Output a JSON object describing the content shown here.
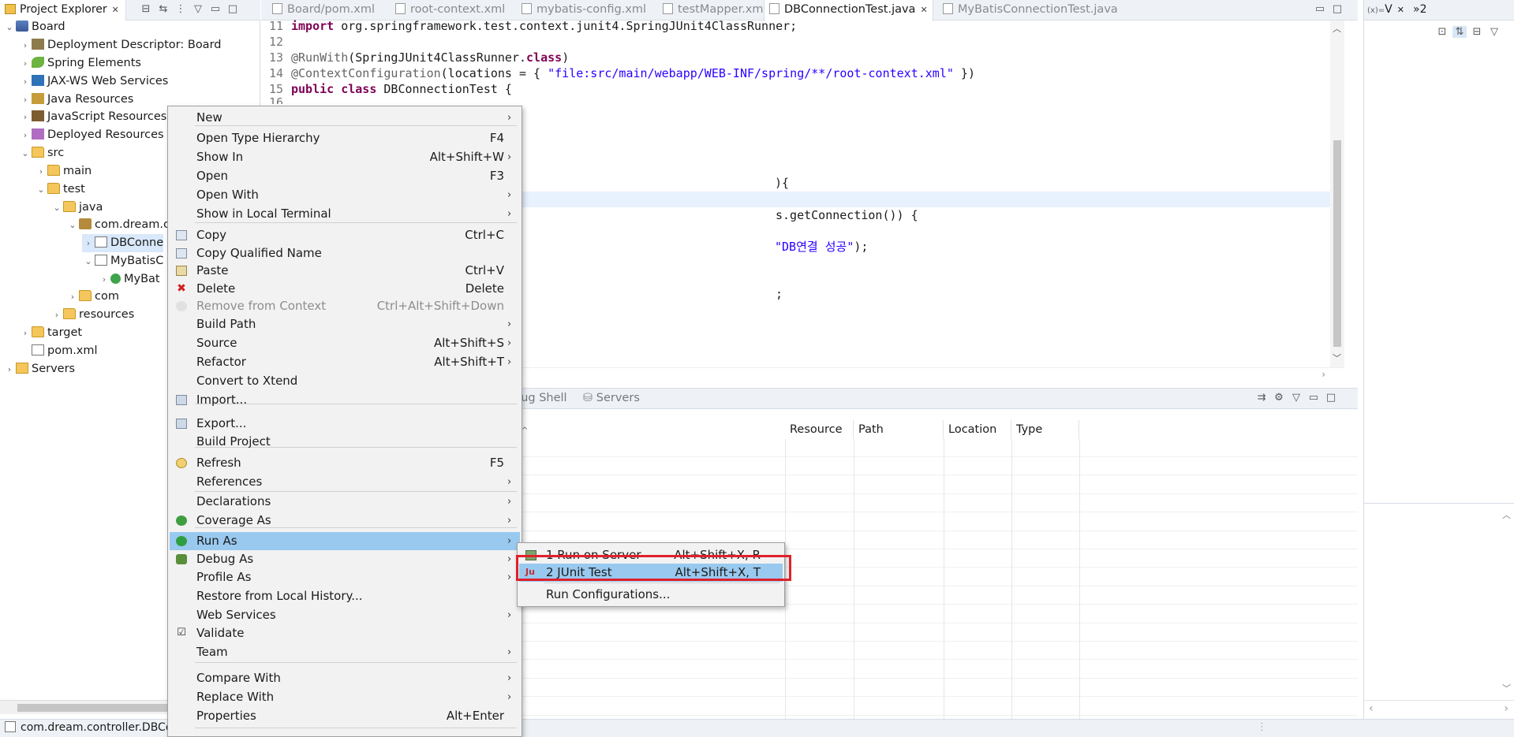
{
  "project_explorer": {
    "tab_label": "Project Explorer",
    "close_glyph": "✕",
    "toolbar_icons": [
      "collapse-all-icon",
      "link-with-editor-icon",
      "view-menu-icon",
      "minimize-icon",
      "maximize-icon"
    ],
    "tree": [
      {
        "label": "Board",
        "icon": "project-icon",
        "twisty": "⌄",
        "level": 0
      },
      {
        "label": "Deployment Descriptor: Board",
        "icon": "deployment-descriptor-icon",
        "twisty": "›",
        "level": 1
      },
      {
        "label": "Spring Elements",
        "icon": "spring-icon",
        "twisty": "›",
        "level": 1
      },
      {
        "label": "JAX-WS Web Services",
        "icon": "jaxws-icon",
        "twisty": "›",
        "level": 1
      },
      {
        "label": "Java Resources",
        "icon": "java-resources-icon",
        "twisty": "›",
        "level": 1
      },
      {
        "label": "JavaScript Resources",
        "icon": "javascript-resources-icon",
        "twisty": "›",
        "level": 1
      },
      {
        "label": "Deployed Resources",
        "icon": "deployed-resources-icon",
        "twisty": "›",
        "level": 1
      },
      {
        "label": "src",
        "icon": "folder-icon",
        "twisty": "⌄",
        "level": 1
      },
      {
        "label": "main",
        "icon": "folder-icon",
        "twisty": "›",
        "level": 2
      },
      {
        "label": "test",
        "icon": "folder-icon",
        "twisty": "⌄",
        "level": 2
      },
      {
        "label": "java",
        "icon": "folder-icon",
        "twisty": "⌄",
        "level": 3
      },
      {
        "label": "com.dream.c",
        "icon": "package-icon",
        "twisty": "⌄",
        "level": 4
      },
      {
        "label": "DBConne",
        "icon": "java-file-icon",
        "twisty": "›",
        "level": 5,
        "selected": true
      },
      {
        "label": "MyBatisC",
        "icon": "java-file-icon",
        "twisty": "⌄",
        "level": 5
      },
      {
        "label": "MyBat",
        "icon": "class-icon",
        "twisty": "›",
        "level": 6
      },
      {
        "label": "com",
        "icon": "folder-icon",
        "twisty": "›",
        "level": 4
      },
      {
        "label": "resources",
        "icon": "folder-icon",
        "twisty": "›",
        "level": 3
      },
      {
        "label": "target",
        "icon": "folder-icon",
        "twisty": "›",
        "level": 1
      },
      {
        "label": "pom.xml",
        "icon": "xml-file-icon",
        "twisty": "",
        "level": 1
      },
      {
        "label": "Servers",
        "icon": "servers-folder-icon",
        "twisty": "›",
        "level": 0
      }
    ],
    "status_text": "com.dream.controller.DBCo"
  },
  "editor": {
    "tabs": [
      {
        "label": "Board/pom.xml",
        "active": false
      },
      {
        "label": "root-context.xml",
        "active": false
      },
      {
        "label": "mybatis-config.xml",
        "active": false
      },
      {
        "label": "testMapper.xml",
        "active": false
      },
      {
        "label": "DBConnectionTest.java",
        "active": true
      },
      {
        "label": "MyBatisConnectionTest.java",
        "active": false
      }
    ],
    "code": {
      "l11_num": "11",
      "l11_kw": "import",
      "l11_rest": " org.springframework.test.context.junit4.SpringJUnit4ClassRunner;",
      "l12_num": "12",
      "l13_num": "13",
      "l13_ann": "@RunWith",
      "l13_a": "(SpringJUnit4ClassRunner.",
      "l13_kw": "class",
      "l13_b": ")",
      "l14_num": "14",
      "l14_ann": "@ContextConfiguration",
      "l14_a": "(locations = { ",
      "l14_str": "\"file:src/main/webapp/WEB-INF/spring/**/root-context.xml\"",
      "l14_b": " })",
      "l15_num": "15",
      "l15_kw1": "public",
      "l15_kw2": "class",
      "l15_rest": " DBConnectionTest {",
      "l16_num": "16",
      "frag_brace": "){",
      "frag_conn": "s.getConnection()) {",
      "frag_str": "\"DB연결 성공\"",
      "frag_end": ");",
      "frag_semi": ";"
    }
  },
  "bottom_panel": {
    "tabs": [
      "bug Shell",
      "Servers"
    ],
    "columns": [
      "Resource",
      "Path",
      "Location",
      "Type"
    ]
  },
  "right_panel": {
    "tab_label": "V",
    "overflow_label": "»2"
  },
  "context_menu": {
    "items": [
      {
        "label": "New",
        "shortcut": "",
        "submenu": true
      },
      {
        "sep": true
      },
      {
        "label": "Open Type Hierarchy",
        "shortcut": "F4"
      },
      {
        "label": "Show In",
        "shortcut": "Alt+Shift+W",
        "submenu": true
      },
      {
        "label": "Open",
        "shortcut": "F3"
      },
      {
        "label": "Open With",
        "shortcut": "",
        "submenu": true
      },
      {
        "label": "Show in Local Terminal",
        "shortcut": "",
        "submenu": true
      },
      {
        "sep": true
      },
      {
        "label": "Copy",
        "shortcut": "Ctrl+C",
        "icon": "copy-icon"
      },
      {
        "label": "Copy Qualified Name",
        "shortcut": "",
        "icon": "copy-qualified-icon"
      },
      {
        "label": "Paste",
        "shortcut": "Ctrl+V",
        "icon": "paste-icon"
      },
      {
        "label": "Delete",
        "shortcut": "Delete",
        "icon": "delete-icon"
      },
      {
        "label": "Remove from Context",
        "shortcut": "Ctrl+Alt+Shift+Down",
        "disabled": true,
        "icon": "remove-context-icon"
      },
      {
        "label": "Build Path",
        "shortcut": "",
        "submenu": true
      },
      {
        "label": "Source",
        "shortcut": "Alt+Shift+S",
        "submenu": true
      },
      {
        "label": "Refactor",
        "shortcut": "Alt+Shift+T",
        "submenu": true
      },
      {
        "label": "Convert to Xtend",
        "shortcut": ""
      },
      {
        "sep": true
      },
      {
        "label": "Import...",
        "shortcut": "",
        "icon": "import-icon"
      },
      {
        "label": "Export...",
        "shortcut": "",
        "icon": "export-icon"
      },
      {
        "sep": true
      },
      {
        "label": "Build Project",
        "shortcut": ""
      },
      {
        "label": "Refresh",
        "shortcut": "F5",
        "icon": "refresh-icon"
      },
      {
        "sep": true
      },
      {
        "label": "References",
        "shortcut": "",
        "submenu": true
      },
      {
        "label": "Declarations",
        "shortcut": "",
        "submenu": true
      },
      {
        "sep": true
      },
      {
        "label": "Coverage As",
        "shortcut": "",
        "submenu": true,
        "icon": "coverage-icon"
      },
      {
        "label": "Run As",
        "shortcut": "",
        "submenu": true,
        "icon": "run-icon",
        "highlighted": true
      },
      {
        "label": "Debug As",
        "shortcut": "",
        "submenu": true,
        "icon": "debug-icon"
      },
      {
        "label": "Profile As",
        "shortcut": "",
        "submenu": true
      },
      {
        "label": "Restore from Local History...",
        "shortcut": ""
      },
      {
        "label": "Web Services",
        "shortcut": "",
        "submenu": true
      },
      {
        "label": "Validate",
        "shortcut": "",
        "icon": "validate-check-icon"
      },
      {
        "sep": true
      },
      {
        "label": "Team",
        "shortcut": "",
        "submenu": true
      },
      {
        "label": "Compare With",
        "shortcut": "",
        "submenu": true
      },
      {
        "label": "Replace With",
        "shortcut": "",
        "submenu": true
      },
      {
        "sep": true
      },
      {
        "label": "Properties",
        "shortcut": "Alt+Enter"
      }
    ],
    "submenu_glyph": "›"
  },
  "run_as_submenu": {
    "items": [
      {
        "label": "1 Run on Server",
        "shortcut": "Alt+Shift+X, R",
        "icon": "run-on-server-icon"
      },
      {
        "label": "2 JUnit Test",
        "shortcut": "Alt+Shift+X, T",
        "icon": "junit-icon",
        "highlighted": true
      },
      {
        "sep": true
      },
      {
        "label": "Run Configurations...",
        "shortcut": ""
      }
    ]
  },
  "colors": {
    "menu_highlight": "#99c9ef",
    "annotation_box": "#e0202a",
    "keyword": "#7f0055",
    "string": "#2a00ff"
  }
}
